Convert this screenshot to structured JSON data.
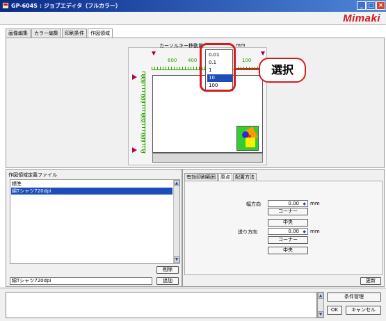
{
  "window": {
    "title": "GP-604S : ジョブエディタ（フルカラー）",
    "logo": "Mimaki",
    "controls": {
      "minimize": "_",
      "maximize": "□",
      "close": "×"
    }
  },
  "tabs": [
    "画像編集",
    "カラー編集",
    "印刷条件",
    "作図領域"
  ],
  "preview": {
    "cursor_label": "カーソルキー移動量",
    "unit": "mm",
    "dropdown_options": [
      "0.01",
      "0.1",
      "1",
      "10",
      "100"
    ],
    "dropdown_selected": "10",
    "ruler_top": [
      "600",
      "400",
      "100"
    ],
    "ruler_left": [
      "400",
      "300",
      "200",
      "100",
      "0"
    ]
  },
  "callout": {
    "text": "選択"
  },
  "definition_panel": {
    "title": "作図領域定義ファイル",
    "items": [
      "標準",
      "綿Tシャツ720dpi"
    ],
    "selected": "綿Tシャツ720dpi",
    "delete_label": "削除",
    "name_value": "綿Tシャツ720dpi",
    "add_label": "追加"
  },
  "origin_panel": {
    "tabs": [
      "有効印刷範囲",
      "原点",
      "配置方法"
    ],
    "active_tab": "原点",
    "width_label": "幅方向",
    "width_value": "0.00",
    "feed_label": "送り方向",
    "feed_value": "0.00",
    "unit": "mm",
    "corner_label": "コーナー",
    "center_label": "中央",
    "update_label": "更新"
  },
  "footer": {
    "condition_label": "条件管理",
    "ok_label": "OK",
    "cancel_label": "キャンセル"
  },
  "colors": {
    "title_bar": "#0a2a8a",
    "selection": "#1e4cb8",
    "callout": "#d41c20",
    "logo": "#d4141c",
    "ruler": "#2aa000"
  },
  "icons": [
    "app-icon",
    "minimize-icon",
    "maximize-icon",
    "close-icon",
    "scroll-up-icon",
    "scroll-down-icon",
    "spin-icon",
    "origin-marker-icon"
  ]
}
